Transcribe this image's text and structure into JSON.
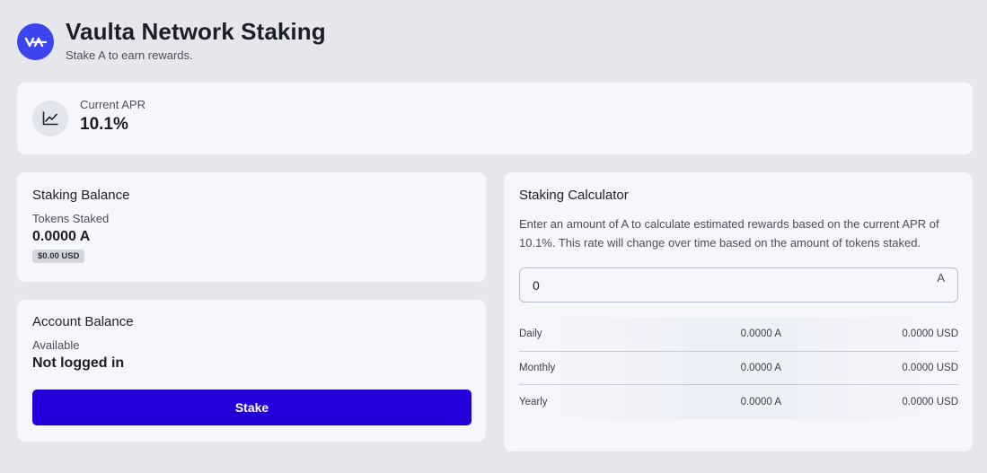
{
  "header": {
    "title": "Vaulta Network Staking",
    "subtitle": "Stake A to earn rewards.",
    "logo_icon": "vaulta-logo-icon"
  },
  "apr": {
    "label": "Current APR",
    "value": "10.1%",
    "icon": "line-chart-icon"
  },
  "staking_balance": {
    "title": "Staking Balance",
    "label": "Tokens Staked",
    "value": "0.0000 A",
    "usd_badge": "$0.00 USD"
  },
  "account_balance": {
    "title": "Account Balance",
    "label": "Available",
    "value": "Not logged in",
    "stake_label": "Stake"
  },
  "calculator": {
    "title": "Staking Calculator",
    "description": "Enter an amount of A to calculate estimated rewards based on the current APR of 10.1%. This rate will change over time based on the amount of tokens staked.",
    "input_value": "0",
    "input_unit": "A",
    "rows": [
      {
        "label": "Daily",
        "token": "0.0000 A",
        "usd": "0.0000 USD"
      },
      {
        "label": "Monthly",
        "token": "0.0000 A",
        "usd": "0.0000 USD"
      },
      {
        "label": "Yearly",
        "token": "0.0000 A",
        "usd": "0.0000 USD"
      }
    ]
  },
  "colors": {
    "accent": "#2100dc",
    "logo": "#3d45f0",
    "background": "#e6e7ed",
    "card": "#f6f7fc"
  }
}
